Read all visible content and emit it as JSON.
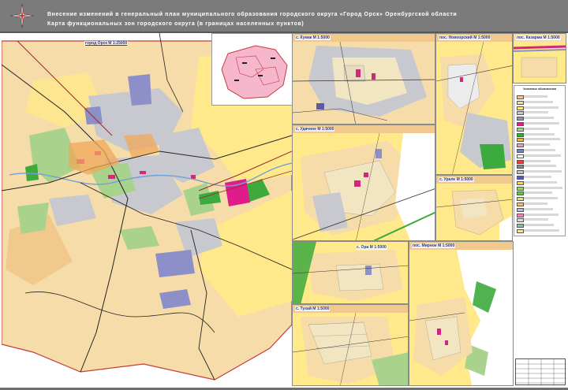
{
  "header": {
    "title_line1": "Внесение изменений в генеральный план муниципального образования городского округа «Город Орск» Оренбургской области",
    "title_line2": "Карта функциональных зон городского округа (в границах населенных пунктов)"
  },
  "main_map": {
    "title": "город Орск М 1:25000"
  },
  "insets": {
    "kumak": "с. Кумак М 1:5000",
    "novo": "пос. Новоорский М 1:5000",
    "kazarma": "пос. Казарма М 1:5000",
    "udachnoe": "с. Удачное М 1:5000",
    "urale": "с. Урале М 1:5000",
    "ora": "с. Ора М 1:5000",
    "mirnoe": "пос. Мирное М 1:5000",
    "tuhai": "с. Тухай М 1:5000"
  },
  "legend": {
    "title": "Условные обозначения",
    "swatches": [
      "#f2c98c",
      "#f6dca8",
      "#ffe98a",
      "#c8c8cf",
      "#8d8fc9",
      "#d2287c",
      "#a9d28c",
      "#3daa3d",
      "#e8b84f",
      "#f2a0b8",
      "#7f7fb8",
      "#ffffff",
      "#e84040",
      "#888888",
      "#c0c0c0",
      "#5a5aa8",
      "#ffd34d",
      "#9ad07a",
      "#6fbf4f",
      "#d6e86f",
      "#ecc27a",
      "#b9b9d9",
      "#ef8ab0",
      "#dcdcdc",
      "#8fbf8f",
      "#f6e5a0"
    ]
  },
  "colors": {
    "residential_low": "#f2c98c",
    "agricultural": "#ffe98a",
    "industrial": "#c8c8cf",
    "public_business": "#8d8fc9",
    "social": "#d2287c",
    "recreation": "#a9d28c",
    "forest": "#3daa3d",
    "water": "#ffffff",
    "header": "#7b7b7b"
  }
}
